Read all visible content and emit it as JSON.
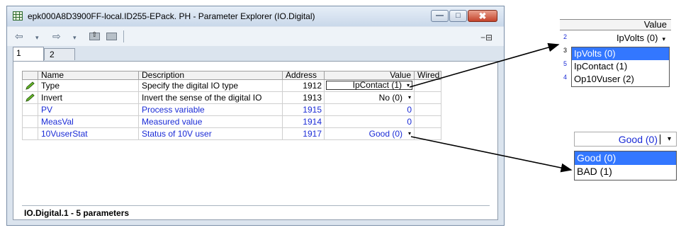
{
  "window": {
    "title": "epk000A8D3900FF-local.ID255-EPack. PH - Parameter Explorer (IO.Digital)",
    "minimize_glyph": "—",
    "maximize_glyph": "□",
    "close_glyph": "✖"
  },
  "toolbar": {
    "back_glyph": "⇦",
    "dropdown_glyph": "▾",
    "forward_glyph": "⇨",
    "pin_glyph": "−⊟"
  },
  "tabs": [
    {
      "label": "1"
    },
    {
      "label": "2"
    }
  ],
  "table": {
    "headers": {
      "name": "Name",
      "description": "Description",
      "address": "Address",
      "value": "Value",
      "wired": "Wired"
    },
    "rows": [
      {
        "name": "Type",
        "description": "Specify the digital IO type",
        "address": "1912",
        "value": "IpContact (1)",
        "editable": true,
        "dropdown": true,
        "color": "#000000"
      },
      {
        "name": "Invert",
        "description": "Invert the sense of the digital IO",
        "address": "1913",
        "value": "No (0)",
        "editable": true,
        "dropdown": true,
        "color": "#000000"
      },
      {
        "name": "PV",
        "description": "Process variable",
        "address": "1915",
        "value": "0",
        "editable": false,
        "dropdown": false,
        "color": "#1a2bd6"
      },
      {
        "name": "MeasVal",
        "description": "Measured value",
        "address": "1914",
        "value": "0",
        "editable": false,
        "dropdown": false,
        "color": "#1a2bd6"
      },
      {
        "name": "10VuserStat",
        "description": "Status of 10V user",
        "address": "1917",
        "value": "Good (0)",
        "editable": false,
        "dropdown": true,
        "color": "#1a2bd6"
      }
    ],
    "dropdown_glyph": "▾"
  },
  "status": "IO.Digital.1  -  5 parameters",
  "zoom_type": {
    "header": "Value",
    "selected": "IpVolts (0)",
    "options": [
      "IpVolts (0)",
      "IpContact (1)",
      "Op10Vuser (2)"
    ],
    "highlighted_index": 0,
    "edge_chars": [
      "2",
      "3",
      "5",
      "4"
    ]
  },
  "zoom_status": {
    "selected": "Good (0)",
    "options": [
      "Good (0)",
      "BAD (1)"
    ],
    "highlighted_index": 0
  },
  "colors": {
    "highlight": "#3377ff",
    "param_blue": "#1a2bd6",
    "close_red": "#c4432b"
  }
}
